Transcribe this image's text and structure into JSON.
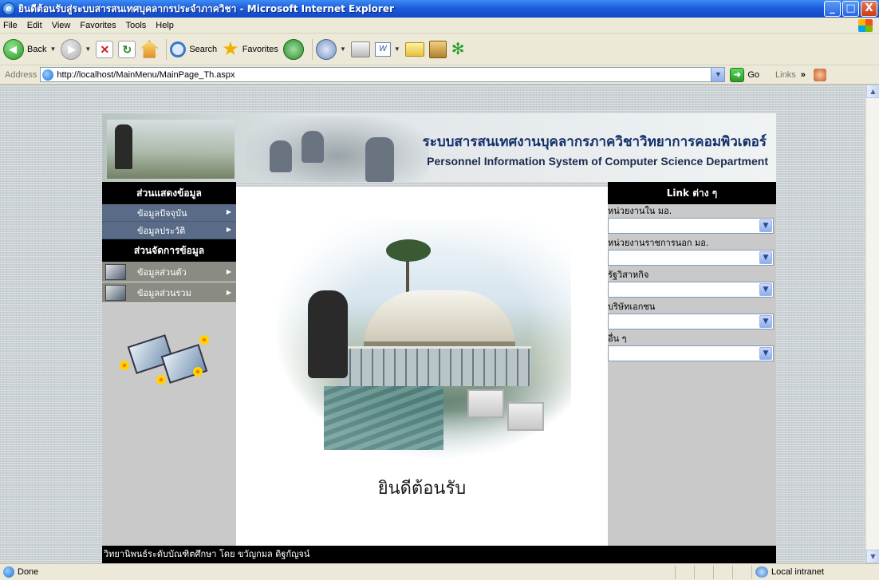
{
  "window": {
    "title": "ยินดีต้อนรับสู่ระบบสารสนเทศบุคลากรประจำภาควิชา - Microsoft Internet Explorer",
    "buttons": {
      "minimize": "_",
      "maximize": "□",
      "close": "X"
    }
  },
  "menubar": {
    "items": [
      "File",
      "Edit",
      "View",
      "Favorites",
      "Tools",
      "Help"
    ]
  },
  "toolbar": {
    "back_label": "Back",
    "search_label": "Search",
    "favorites_label": "Favorites"
  },
  "address": {
    "label": "Address",
    "url": "http://localhost/MainMenu/MainPage_Th.aspx",
    "go_label": "Go",
    "links_label": "Links"
  },
  "banner": {
    "title_th": "ระบบสารสนเทศงานบุคลากรภาควิชาวิทยาการคอมพิวเตอร์",
    "title_en": "Personnel Information System of Computer Science Department"
  },
  "leftnav": {
    "display_header": "ส่วนแสดงข้อมูล",
    "display_items": [
      "ข้อมูลปัจจุบัน",
      "ข้อมูลประวัติ"
    ],
    "manage_header": "ส่วนจัดการข้อมูล",
    "manage_items": [
      "ข้อมูลส่วนตัว",
      "ข้อมูลส่วนรวม"
    ]
  },
  "center": {
    "welcome": "ยินดีต้อนรับ"
  },
  "links": {
    "header": "Link ต่าง ๆ",
    "groups": [
      {
        "label": "หน่วยงานใน มอ.",
        "value": ""
      },
      {
        "label": "หน่วยงานราชการนอก มอ.",
        "value": ""
      },
      {
        "label": "รัฐวิสาหกิจ",
        "value": ""
      },
      {
        "label": "บริษัทเอกชน",
        "value": ""
      },
      {
        "label": "อื่น ๆ",
        "value": ""
      }
    ]
  },
  "footer": {
    "text": "วิทยานิพนธ์ระดับบัณฑิตศึกษา โดย ขวัญกมล ดิฐกัญจน์"
  },
  "statusbar": {
    "status": "Done",
    "zone": "Local intranet"
  }
}
